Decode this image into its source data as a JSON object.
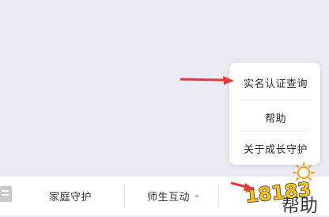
{
  "popup_menu": {
    "items": [
      {
        "label": "实名认证查询"
      },
      {
        "label": "帮助"
      },
      {
        "label": "关于成长守护"
      }
    ]
  },
  "bottom_bar": {
    "family_label": "家庭守护",
    "teacher_label": "师生互动",
    "help_label": "帮助"
  },
  "watermark": {
    "text": "18183"
  },
  "colors": {
    "background": "#e9eaf2",
    "arrow": "#e53a35",
    "logo_yellow": "#f7c21b"
  }
}
